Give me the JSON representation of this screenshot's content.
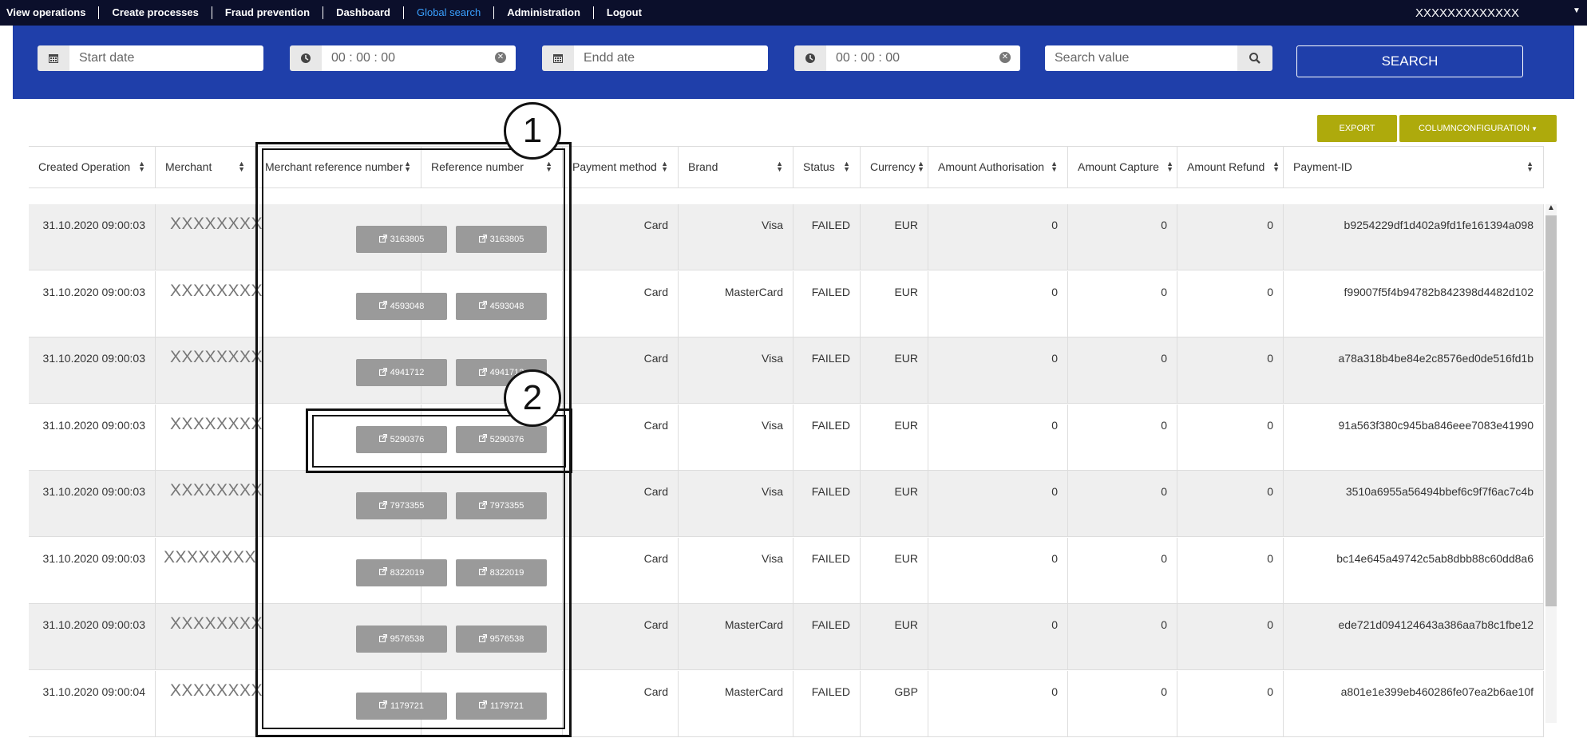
{
  "nav": {
    "items": [
      "View operations",
      "Create processes",
      "Fraud prevention",
      "Dashboard",
      "Global search",
      "Administration",
      "Logout"
    ],
    "active": "Global search",
    "user": "XXXXXXXXXXXXX"
  },
  "filters": {
    "start_date_placeholder": "Start date",
    "start_time": "00 : 00 : 00",
    "end_date_placeholder": "Endd ate",
    "end_time": "00 : 00 : 00",
    "search_placeholder": "Search value",
    "search_button": "SEARCH"
  },
  "actions": {
    "export": "EXPORT",
    "column_config": "COLUMNCONFIGURATION"
  },
  "table": {
    "headers": [
      "Created Operation",
      "Merchant",
      "Merchant reference number",
      "Reference number",
      "Payment method",
      "Brand",
      "Status",
      "Currency",
      "Amount Authorisation",
      "Amount Capture",
      "Amount Refund",
      "Payment-ID"
    ],
    "rows": [
      {
        "created": "31.10.2020 09:00:03",
        "merchant": "XXXXXXXX",
        "merchant_ref": "3163805",
        "ref": "3163805",
        "method": "Card",
        "brand": "Visa",
        "status": "FAILED",
        "currency": "EUR",
        "auth": "0",
        "capture": "0",
        "refund": "0",
        "payment_id": "b9254229df1d402a9fd1fe161394a098"
      },
      {
        "created": "31.10.2020 09:00:03",
        "merchant": "XXXXXXXX",
        "merchant_ref": "4593048",
        "ref": "4593048",
        "method": "Card",
        "brand": "MasterCard",
        "status": "FAILED",
        "currency": "EUR",
        "auth": "0",
        "capture": "0",
        "refund": "0",
        "payment_id": "f99007f5f4b94782b842398d4482d102"
      },
      {
        "created": "31.10.2020 09:00:03",
        "merchant": "XXXXXXXX",
        "merchant_ref": "4941712",
        "ref": "4941712",
        "method": "Card",
        "brand": "Visa",
        "status": "FAILED",
        "currency": "EUR",
        "auth": "0",
        "capture": "0",
        "refund": "0",
        "payment_id": "a78a318b4be84e2c8576ed0de516fd1b"
      },
      {
        "created": "31.10.2020 09:00:03",
        "merchant": "XXXXXXXX",
        "merchant_ref": "5290376",
        "ref": "5290376",
        "method": "Card",
        "brand": "Visa",
        "status": "FAILED",
        "currency": "EUR",
        "auth": "0",
        "capture": "0",
        "refund": "0",
        "payment_id": "91a563f380c945ba846eee7083e41990"
      },
      {
        "created": "31.10.2020 09:00:03",
        "merchant": "XXXXXXXX",
        "merchant_ref": "7973355",
        "ref": "7973355",
        "method": "Card",
        "brand": "Visa",
        "status": "FAILED",
        "currency": "EUR",
        "auth": "0",
        "capture": "0",
        "refund": "0",
        "payment_id": "3510a6955a56494bbef6c9f7f6ac7c4b"
      },
      {
        "created": "31.10.2020 09:00:03",
        "merchant": "XXXXXXXX",
        "merchant_ref": "8322019",
        "ref": "8322019",
        "method": "Card",
        "brand": "Visa",
        "status": "FAILED",
        "currency": "EUR",
        "auth": "0",
        "capture": "0",
        "refund": "0",
        "payment_id": "bc14e645a49742c5ab8dbb88c60dd8a6"
      },
      {
        "created": "31.10.2020 09:00:03",
        "merchant": "XXXXXXXX",
        "merchant_ref": "9576538",
        "ref": "9576538",
        "method": "Card",
        "brand": "MasterCard",
        "status": "FAILED",
        "currency": "EUR",
        "auth": "0",
        "capture": "0",
        "refund": "0",
        "payment_id": "ede721d094124643a386aa7b8c1fbe12"
      },
      {
        "created": "31.10.2020 09:00:04",
        "merchant": "XXXXXXXX",
        "merchant_ref": "1179721",
        "ref": "1179721",
        "method": "Card",
        "brand": "MasterCard",
        "status": "FAILED",
        "currency": "GBP",
        "auth": "0",
        "capture": "0",
        "refund": "0",
        "payment_id": "a801e1e399eb460286fe07ea2b6ae10f"
      }
    ]
  },
  "annotations": {
    "callout1": "1",
    "callout2": "2"
  }
}
